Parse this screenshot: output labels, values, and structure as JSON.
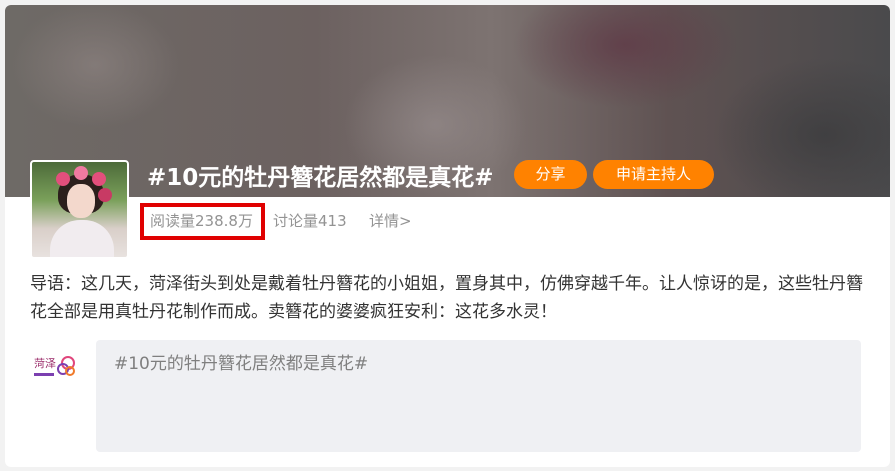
{
  "topic": {
    "title": "#10元的牡丹簪花居然都是真花#",
    "share_label": "分享",
    "host_label": "申请主持人"
  },
  "stats": {
    "reads": "阅读量238.8万",
    "discussions": "讨论量413",
    "details": "详情>"
  },
  "intro_text": "导语：这几天，菏泽街头到处是戴着牡丹簪花的小姐姐，置身其中，仿佛穿越千年。让人惊讶的是，这些牡丹簪花全部是用真牡丹花制作而成。卖簪花的婆婆疯狂安利：这花多水灵！",
  "composer": {
    "text": "#10元的牡丹簪花居然都是真花#",
    "logo_text": "菏泽"
  },
  "colors": {
    "accent": "#ff8200",
    "highlight_box": "#e00000",
    "muted_text": "#939393"
  },
  "icons": {
    "avatar": "topic-avatar-photo",
    "logo": "heze-logo-icon"
  }
}
